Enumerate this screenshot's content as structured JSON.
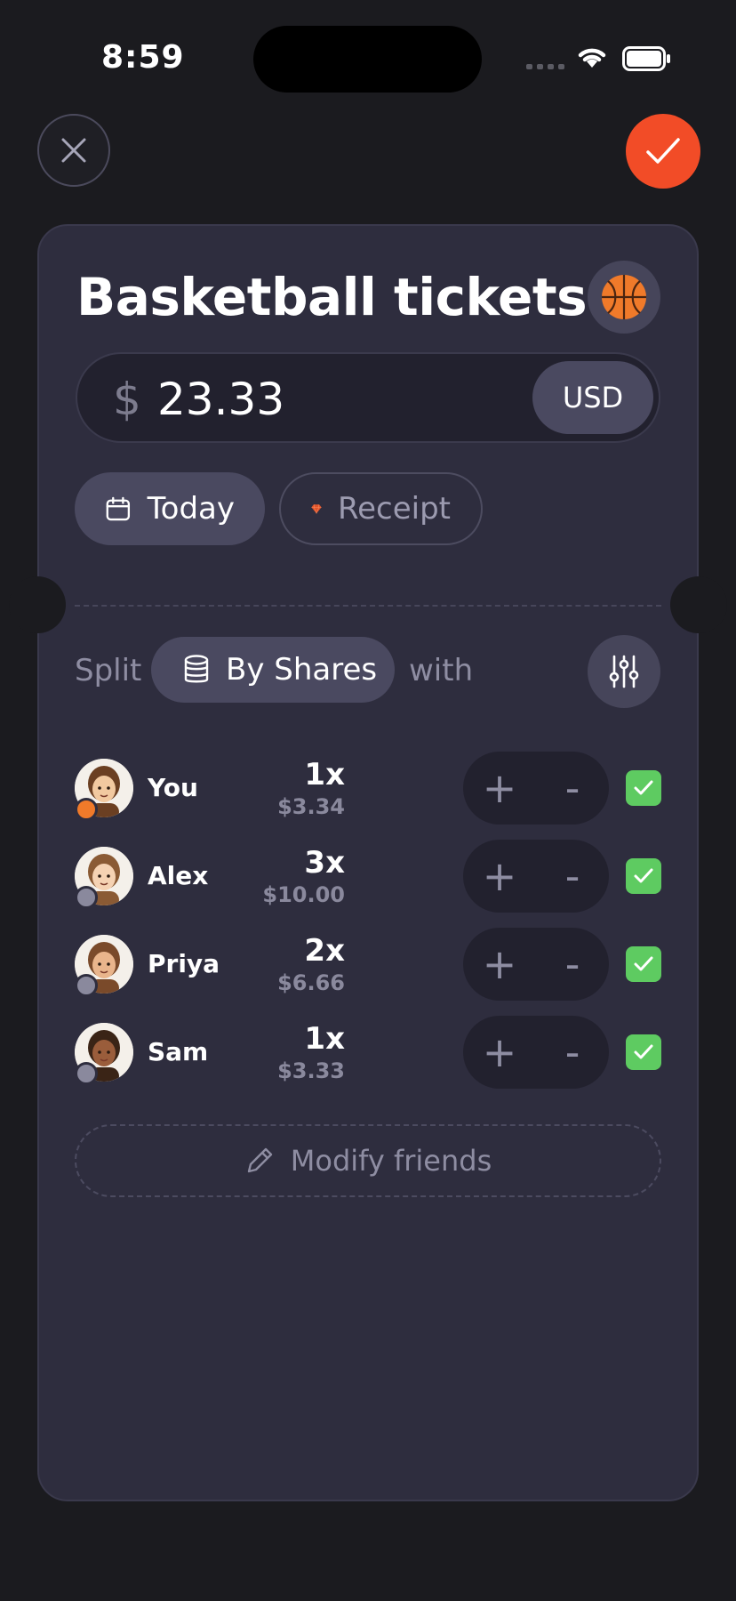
{
  "status_bar": {
    "time": "8:59"
  },
  "expense": {
    "title": "Basketball tickets",
    "category_icon": "basketball-icon",
    "currency_symbol": "$",
    "amount": "23.33",
    "currency": "USD"
  },
  "chips": {
    "date_label": "Today",
    "receipt_label": "Receipt"
  },
  "split": {
    "label": "Split",
    "mode": "By Shares",
    "with_label": "with"
  },
  "participants": [
    {
      "name": "You",
      "shares": "1x",
      "amount": "$3.34",
      "checked": true,
      "badge_color": "#f07a2a"
    },
    {
      "name": "Alex",
      "shares": "3x",
      "amount": "$10.00",
      "checked": true,
      "badge_color": "#8a899d"
    },
    {
      "name": "Priya",
      "shares": "2x",
      "amount": "$6.66",
      "checked": true,
      "badge_color": "#8a899d"
    },
    {
      "name": "Sam",
      "shares": "1x",
      "amount": "$3.33",
      "checked": true,
      "badge_color": "#8a899d"
    }
  ],
  "stepper": {
    "plus": "+",
    "minus": "-"
  },
  "modify_friends_label": "Modify friends",
  "colors": {
    "accent": "#f24c27",
    "check": "#5ecb61",
    "card": "#2e2d3e",
    "background": "#1b1b1f"
  }
}
